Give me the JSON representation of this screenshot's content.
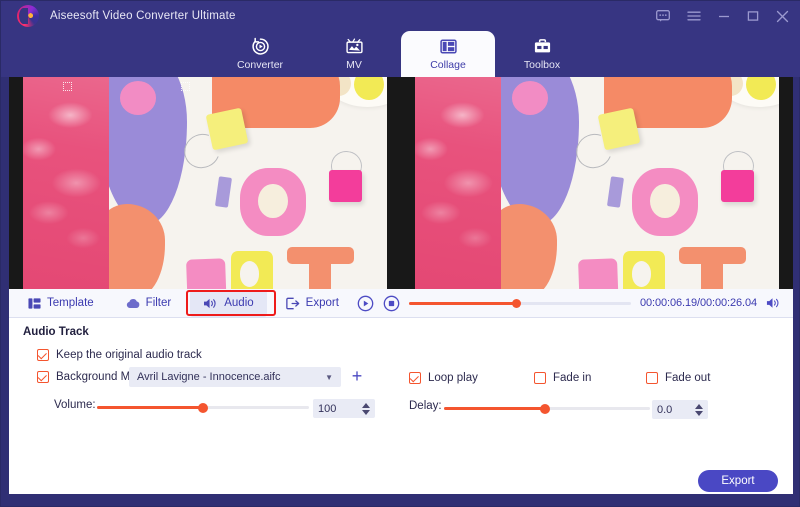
{
  "window": {
    "title": "Aiseesoft Video Converter Ultimate",
    "logo_icon": "aiseesoft-logo-icon",
    "controls": [
      {
        "name": "feedback-icon",
        "label": ""
      },
      {
        "name": "menu-icon",
        "label": ""
      },
      {
        "name": "minimize-icon",
        "label": ""
      },
      {
        "name": "maximize-icon",
        "label": ""
      },
      {
        "name": "close-icon",
        "label": ""
      }
    ]
  },
  "main_tabs": [
    {
      "label": "Converter",
      "icon": "converter-icon",
      "active": false
    },
    {
      "label": "MV",
      "icon": "mv-icon",
      "active": false
    },
    {
      "label": "Collage",
      "icon": "collage-icon",
      "active": true
    },
    {
      "label": "Toolbox",
      "icon": "toolbox-icon",
      "active": false
    }
  ],
  "tool_tabs": [
    {
      "label": "Template",
      "icon": "template-icon",
      "active": false
    },
    {
      "label": "Filter",
      "icon": "filter-icon",
      "active": false
    },
    {
      "label": "Audio",
      "icon": "audio-icon",
      "active": true
    },
    {
      "label": "Export",
      "icon": "export-icon",
      "active": false
    }
  ],
  "player": {
    "play_icon": "play-icon",
    "stop_icon": "stop-icon",
    "volume_icon": "speaker-icon",
    "timecode": "00:00:06.19/00:00:26.04",
    "progress_percent": 48
  },
  "audio_panel": {
    "section_title": "Audio Track",
    "keep_original": {
      "label": "Keep the original audio track",
      "checked": true
    },
    "background_music": {
      "label": "Background Music",
      "checked": true
    },
    "music_file": "Avril Lavigne - Innocence.aifc",
    "add_icon": "plus-icon",
    "dropdown_icon": "chevron-down-icon",
    "volume": {
      "label": "Volume:",
      "value": "100",
      "percent": 50
    },
    "delay": {
      "label": "Delay:",
      "value": "0.0",
      "percent": 49
    },
    "loop_play": {
      "label": "Loop play",
      "checked": true
    },
    "fade_in": {
      "label": "Fade in",
      "checked": false
    },
    "fade_out": {
      "label": "Fade out",
      "checked": false
    }
  },
  "footer": {
    "export_label": "Export"
  },
  "colors": {
    "brand_indigo": "#373582",
    "accent_orange": "#f4552f",
    "tab_active_bg": "#fbfbfe",
    "highlight_red": "#ee1b1b",
    "button_blue": "#4a48c4"
  }
}
